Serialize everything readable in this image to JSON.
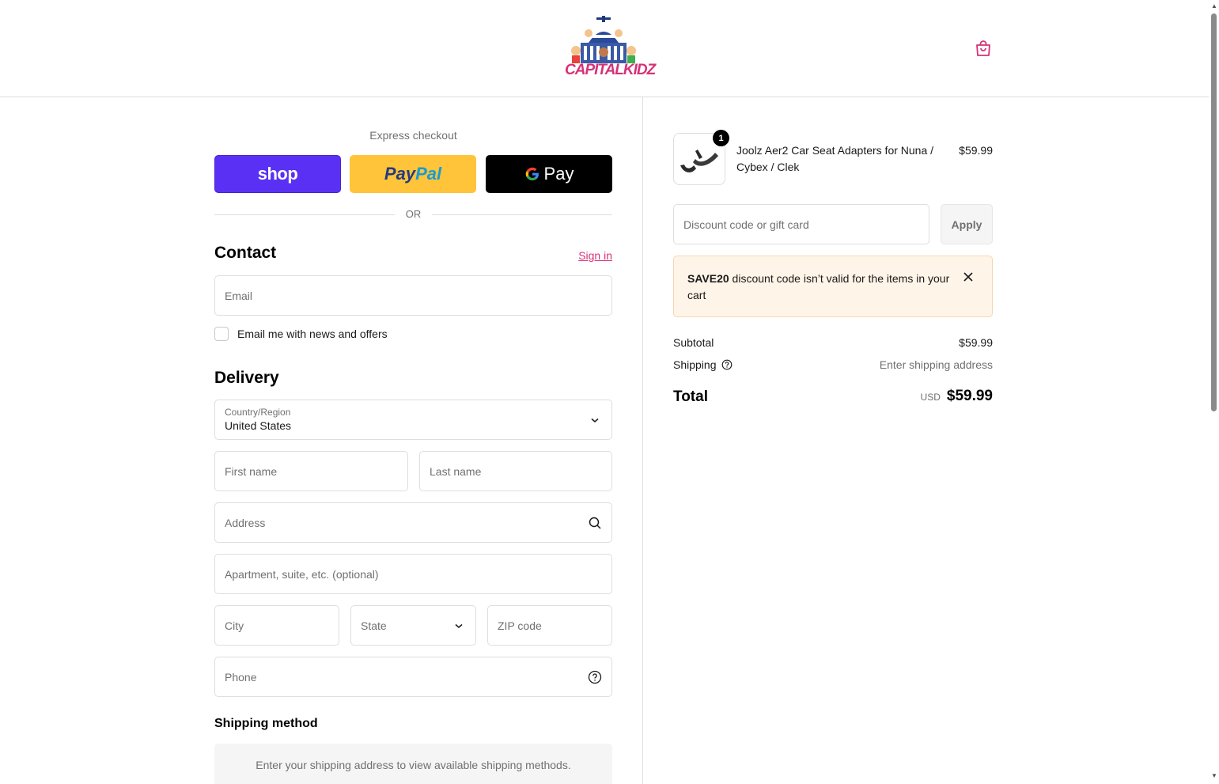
{
  "header": {
    "logo_text": "CAPITALKIDZ",
    "cart_icon": "shopping-bag-icon"
  },
  "express": {
    "title": "Express checkout",
    "shop_label": "shop",
    "paypal_label_1": "Pay",
    "paypal_label_2": "Pal",
    "gpay_g": "G",
    "gpay_label": "Pay",
    "or_text": "OR"
  },
  "contact": {
    "title": "Contact",
    "sign_in": "Sign in",
    "email_placeholder": "Email",
    "newsletter_label": "Email me with news and offers"
  },
  "delivery": {
    "title": "Delivery",
    "country_label": "Country/Region",
    "country_value": "United States",
    "first_name": "First name",
    "last_name": "Last name",
    "address": "Address",
    "apartment": "Apartment, suite, etc. (optional)",
    "city": "City",
    "state": "State",
    "zip": "ZIP code",
    "phone": "Phone"
  },
  "shipping_method": {
    "title": "Shipping method",
    "message": "Enter your shipping address to view available shipping methods."
  },
  "summary": {
    "item": {
      "quantity": "1",
      "name": "Joolz Aer2 Car Seat Adapters for Nuna / Cybex / Clek",
      "price": "$59.99"
    },
    "discount_placeholder": "Discount code or gift card",
    "apply_label": "Apply",
    "alert_code": "SAVE20",
    "alert_text": " discount code isn’t valid for the items in your cart",
    "subtotal_label": "Subtotal",
    "subtotal_value": "$59.99",
    "shipping_label": "Shipping",
    "shipping_value": "Enter shipping address",
    "total_label": "Total",
    "total_currency": "USD",
    "total_value": "$59.99"
  },
  "colors": {
    "accent": "#d6317a",
    "shop_pay": "#5a31f4",
    "paypal": "#ffc439",
    "gpay": "#000000",
    "alert_bg": "#fff4e8"
  }
}
